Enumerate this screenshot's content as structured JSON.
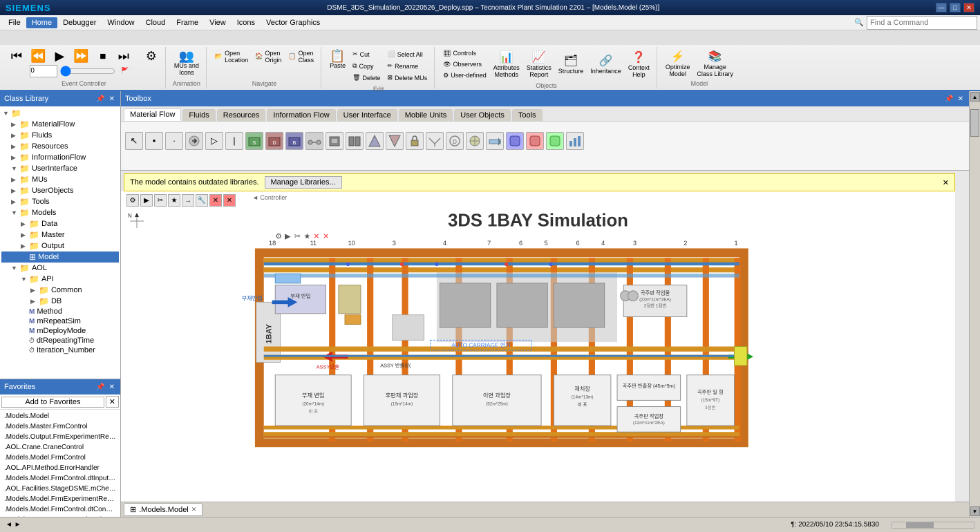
{
  "titleBar": {
    "title": "DSME_3DS_Simulation_20220526_Deploy.spp – Tecnomatix Plant Simulation 2201 – [Models.Model (25%)]",
    "siemensLogo": "SIEMENS",
    "winControls": [
      "—",
      "□",
      "✕"
    ]
  },
  "menuBar": {
    "items": [
      "File",
      "Home",
      "Debugger",
      "Window",
      "Cloud",
      "Frame",
      "View",
      "Icons",
      "Vector Graphics"
    ],
    "activeItem": "Home"
  },
  "ribbon": {
    "tabs": [
      "Event Controller",
      "Animation",
      "Navigate",
      "Edit"
    ],
    "groups": [
      {
        "id": "event-controller",
        "label": "Event Controller",
        "buttons": []
      },
      {
        "id": "animation",
        "label": "Animation",
        "buttons": [
          {
            "label": "MUs and Icons",
            "icon": "👥"
          }
        ]
      },
      {
        "id": "navigate",
        "label": "Navigate",
        "buttons": [
          {
            "label": "Open Location",
            "icon": "📂"
          },
          {
            "label": "Open Origin",
            "icon": "🏠"
          },
          {
            "label": "Open Class",
            "icon": "📋"
          }
        ]
      },
      {
        "id": "edit",
        "label": "Edit",
        "buttons": [
          {
            "label": "Cut",
            "icon": "✂"
          },
          {
            "label": "Copy",
            "icon": "⧉"
          },
          {
            "label": "Paste",
            "icon": "📋"
          },
          {
            "label": "Delete",
            "icon": "🗑"
          },
          {
            "label": "Select All",
            "icon": "⬜"
          },
          {
            "label": "Rename",
            "icon": "✏"
          },
          {
            "label": "Delete MUs",
            "icon": "⊠"
          }
        ]
      }
    ],
    "objectsGroup": {
      "label": "Objects",
      "buttons": [
        "Attributes Methods",
        "Statistics Report",
        "Structure",
        "Inheritance",
        "Context Help"
      ]
    },
    "modelGroup": {
      "label": "Model",
      "buttons": [
        "Optimize Model",
        "Manage Class Library"
      ]
    }
  },
  "search": {
    "placeholder": "Find a Command"
  },
  "classLibrary": {
    "title": "Class Library",
    "tree": [
      {
        "id": "materialflow",
        "label": "MaterialFlow",
        "indent": 1,
        "icon": "📁",
        "expanded": false
      },
      {
        "id": "fluids",
        "label": "Fluids",
        "indent": 1,
        "icon": "📁",
        "expanded": false
      },
      {
        "id": "resources",
        "label": "Resources",
        "indent": 1,
        "icon": "📁",
        "expanded": false
      },
      {
        "id": "informationflow",
        "label": "InformationFlow",
        "indent": 1,
        "icon": "📁",
        "expanded": false
      },
      {
        "id": "userinterface",
        "label": "UserInterface",
        "indent": 1,
        "icon": "📁",
        "expanded": true
      },
      {
        "id": "mus",
        "label": "MUs",
        "indent": 1,
        "icon": "📁",
        "expanded": false
      },
      {
        "id": "userobjects",
        "label": "UserObjects",
        "indent": 1,
        "icon": "📁",
        "expanded": false
      },
      {
        "id": "tools",
        "label": "Tools",
        "indent": 1,
        "icon": "📁",
        "expanded": false
      },
      {
        "id": "models",
        "label": "Models",
        "indent": 1,
        "icon": "📁",
        "expanded": true
      },
      {
        "id": "data",
        "label": "Data",
        "indent": 2,
        "icon": "📁",
        "expanded": false
      },
      {
        "id": "master",
        "label": "Master",
        "indent": 2,
        "icon": "📁",
        "expanded": false
      },
      {
        "id": "output",
        "label": "Output",
        "indent": 2,
        "icon": "📁",
        "expanded": false
      },
      {
        "id": "model",
        "label": "Model",
        "indent": 2,
        "icon": "⊞",
        "expanded": false,
        "selected": true
      },
      {
        "id": "aol",
        "label": "AOL",
        "indent": 1,
        "icon": "📁",
        "expanded": true
      },
      {
        "id": "api",
        "label": "API",
        "indent": 2,
        "icon": "📁",
        "expanded": false
      },
      {
        "id": "common",
        "label": "Common",
        "indent": 3,
        "icon": "📁",
        "expanded": false
      },
      {
        "id": "db",
        "label": "DB",
        "indent": 3,
        "icon": "📁",
        "expanded": false
      },
      {
        "id": "method",
        "label": "Method",
        "indent": 2,
        "icon": "M",
        "expanded": false
      },
      {
        "id": "mrepeatsim",
        "label": "mRepeatSim",
        "indent": 2,
        "icon": "M",
        "expanded": false
      },
      {
        "id": "mdeploymode",
        "label": "mDeployMode",
        "indent": 2,
        "icon": "M",
        "expanded": false
      },
      {
        "id": "dtrepeatingtime",
        "label": "dtRepeatingTime",
        "indent": 2,
        "icon": "⏱",
        "expanded": false
      },
      {
        "id": "iteration-number",
        "label": "Iteration_Number",
        "indent": 2,
        "icon": "⏱",
        "expanded": false
      }
    ]
  },
  "favorites": {
    "title": "Favorites",
    "addLabel": "Add to Favorites",
    "items": [
      ".Models.Model",
      ".Models.Master.FrmControl",
      ".Models.Output.FrmExperimentResult",
      ".AOL.Crane.CraneControl",
      ".Models.Model.FrmControl",
      ".AOL.API.Method.ErrorHandler",
      ".Models.Model.FrmControl.dtInputPara...",
      ".AOL.Facilities.StageDSME.mCheckCapa...",
      ".Models.Model.FrmExperimentResult.dt...",
      ".Models.Model.FrmControl.dtConveyor...",
      ".Models.Master.FrmControl.mCheckAnd..."
    ]
  },
  "toolbox": {
    "title": "Toolbox",
    "tabs": [
      "Material Flow",
      "Fluids",
      "Resources",
      "Information Flow",
      "User Interface",
      "Mobile Units",
      "User Objects",
      "Tools"
    ],
    "activeTab": "Material Flow",
    "icons": [
      "⚙",
      "⟶",
      "◼",
      "▷",
      "▬",
      "▭",
      "⊞",
      "⊟",
      "⊡",
      "◯",
      "⬡",
      "◉",
      "▤",
      "▥",
      "▦",
      "▧",
      "◪",
      "⧉",
      "⊠",
      "◈",
      "⊕",
      "⊗"
    ]
  },
  "canvas": {
    "warning": "The model contains outdated libraries.",
    "manageLibrariesBtn": "Manage Libraries...",
    "title": "3DS 1BAY Simulation",
    "tabs": [
      {
        "label": "Models.Model",
        "active": true,
        "icon": "⊞"
      }
    ]
  },
  "statusBar": {
    "timestamp": "¶: 2022/05/10 23:54:15.5830",
    "scrollIndicator": ""
  }
}
